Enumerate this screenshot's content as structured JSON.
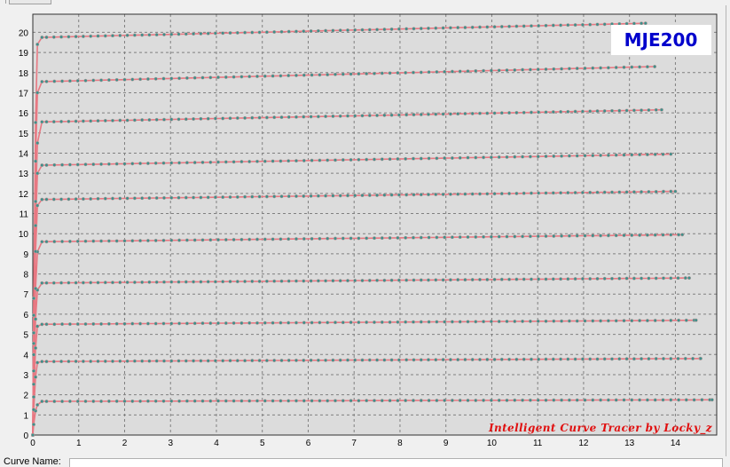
{
  "window": {
    "curve_name_label": "Curve Name:",
    "curve_name_value": ""
  },
  "colors": {
    "plot_bg": "#dcdcdc",
    "grid": "#808080",
    "curve": "#e87882",
    "marker": "#3e8f8a",
    "title": "#0000cc",
    "credit": "#e01010"
  },
  "chart_data": {
    "type": "line",
    "title": "MJE200",
    "annotation": "Intelligent Curve Tracer by Locky_z",
    "xlabel": "",
    "ylabel": "",
    "xlim": [
      0,
      14.9
    ],
    "ylim": [
      0,
      20.9
    ],
    "x_ticks": [
      "0",
      "1",
      "2",
      "3",
      "4",
      "5",
      "6",
      "7",
      "8",
      "9",
      "10",
      "11",
      "12",
      "13",
      "14"
    ],
    "y_ticks": [
      "0",
      "1",
      "2",
      "3",
      "4",
      "5",
      "6",
      "7",
      "8",
      "9",
      "10",
      "11",
      "12",
      "13",
      "14",
      "15",
      "16",
      "17",
      "18",
      "19",
      "20"
    ],
    "grid": true,
    "legend": "none",
    "series": [
      {
        "knee_x": 0.1,
        "knee_y": 1.5,
        "sat_x": 0.2,
        "sat_y": 1.67,
        "end_x": 14.8,
        "end_y": 1.75
      },
      {
        "knee_x": 0.1,
        "knee_y": 3.6,
        "sat_x": 0.2,
        "sat_y": 3.65,
        "end_x": 14.55,
        "end_y": 3.8
      },
      {
        "knee_x": 0.1,
        "knee_y": 5.4,
        "sat_x": 0.2,
        "sat_y": 5.5,
        "end_x": 14.45,
        "end_y": 5.7
      },
      {
        "knee_x": 0.1,
        "knee_y": 7.2,
        "sat_x": 0.2,
        "sat_y": 7.55,
        "end_x": 14.3,
        "end_y": 7.8
      },
      {
        "knee_x": 0.1,
        "knee_y": 9.1,
        "sat_x": 0.2,
        "sat_y": 9.6,
        "end_x": 14.15,
        "end_y": 9.95
      },
      {
        "knee_x": 0.1,
        "knee_y": 11.4,
        "sat_x": 0.2,
        "sat_y": 11.7,
        "end_x": 14.0,
        "end_y": 12.1
      },
      {
        "knee_x": 0.1,
        "knee_y": 13.0,
        "sat_x": 0.2,
        "sat_y": 13.4,
        "end_x": 13.9,
        "end_y": 13.95
      },
      {
        "knee_x": 0.1,
        "knee_y": 14.5,
        "sat_x": 0.2,
        "sat_y": 15.55,
        "end_x": 13.7,
        "end_y": 16.15
      },
      {
        "knee_x": 0.1,
        "knee_y": 17.0,
        "sat_x": 0.2,
        "sat_y": 17.55,
        "end_x": 13.55,
        "end_y": 18.3
      },
      {
        "knee_x": 0.1,
        "knee_y": 19.4,
        "sat_x": 0.2,
        "sat_y": 19.75,
        "end_x": 13.35,
        "end_y": 20.45
      }
    ]
  }
}
